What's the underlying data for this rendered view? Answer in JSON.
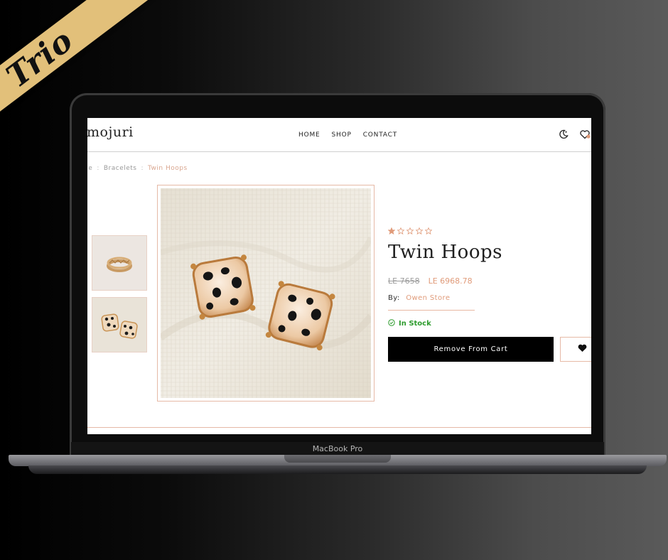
{
  "ribbon": {
    "text": "Trio"
  },
  "laptop": {
    "model_label": "MacBook Pro"
  },
  "site": {
    "logo": "mojuri",
    "nav": [
      "HOME",
      "SHOP",
      "CONTACT"
    ],
    "icons": {
      "theme": "moon-star-icon",
      "wishlist": "heart-icon"
    }
  },
  "breadcrumb": {
    "items": [
      "me",
      "Bracelets",
      "Twin Hoops"
    ],
    "separator": ":"
  },
  "product": {
    "title": "Twin Hoops",
    "rating": 1,
    "rating_max": 5,
    "old_price": "LE 7658",
    "price": "LE 6968.78",
    "seller_label": "By:",
    "seller": "Owen Store",
    "stock": "In Stock",
    "cart_button": "Remove From Cart",
    "thumbnails": [
      "ring",
      "earrings"
    ]
  },
  "colors": {
    "accent": "#e09b7a",
    "border": "#e6b9a6",
    "stock": "#2d9b2d",
    "ribbon": "#e2c07a"
  }
}
